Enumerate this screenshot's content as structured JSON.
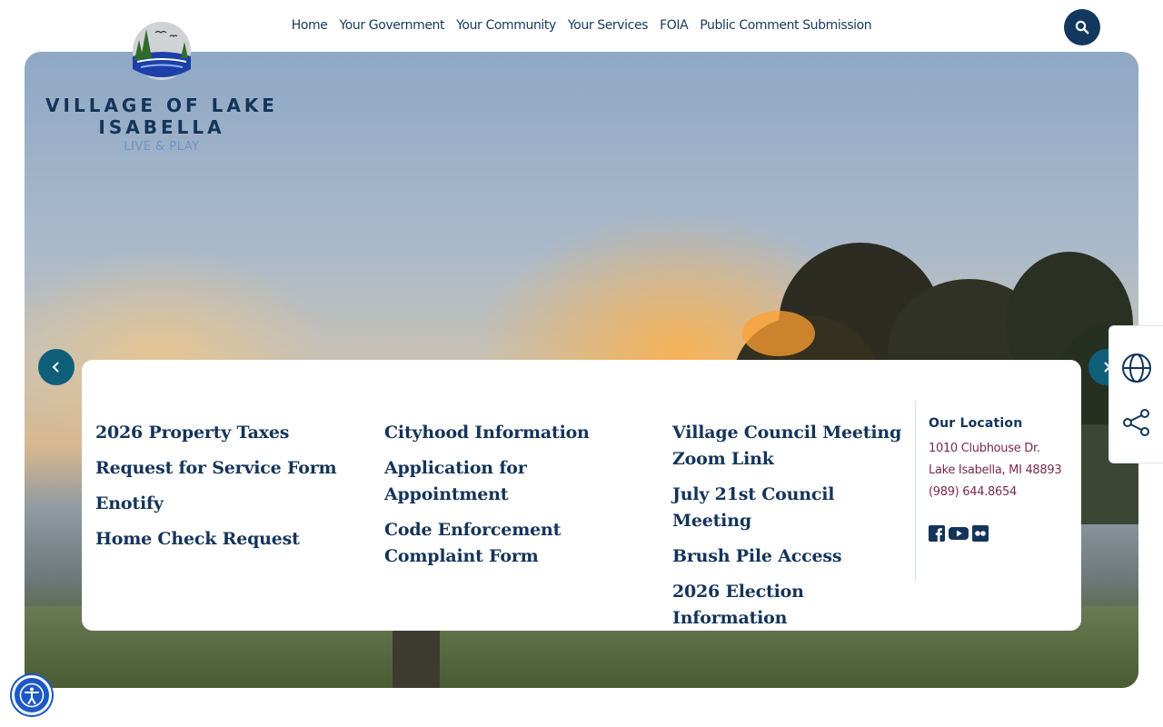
{
  "nav": {
    "items": [
      "Home",
      "Your Government",
      "Your Community",
      "Your Services",
      "FOIA",
      "Public Comment Submission"
    ]
  },
  "logo": {
    "name": "VILLAGE OF LAKE ISABELLA",
    "tagline": "LIVE & PLAY"
  },
  "quick_links": {
    "column1": [
      "2026 Property Taxes",
      "Request for Service Form",
      "Enotify",
      "Home Check Request"
    ],
    "column2": [
      "Cityhood Information",
      "Application for Appointment",
      "Code Enforcement Complaint Form"
    ],
    "column3": [
      "Village Council Meeting Zoom Link",
      "July 21st Council Meeting",
      "Brush Pile Access",
      "2026 Election Information"
    ]
  },
  "location": {
    "title": "Our Location",
    "address1": "1010 Clubhouse Dr.",
    "address2": "Lake Isabella, MI 48893",
    "phone": "(989) 644.8654"
  },
  "icons": {
    "search": "search-icon",
    "prev": "chevron-left-icon",
    "next": "chevron-right-icon",
    "translate": "globe-icon",
    "share": "share-icon",
    "facebook": "facebook-icon",
    "youtube": "youtube-icon",
    "flickr": "flickr-icon",
    "accessibility": "accessibility-icon"
  },
  "colors": {
    "brand_navy": "#14345a",
    "link_maroon": "#7a2a4e",
    "arrow_teal": "#0f5f7b",
    "accessibility_blue": "#1d58c7"
  }
}
